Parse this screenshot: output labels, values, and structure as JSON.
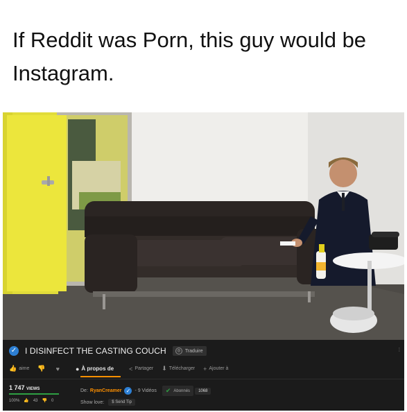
{
  "meme": {
    "caption": "If Reddit was Porn, this guy would be Instagram."
  },
  "video": {
    "title": "I DISINFECT THE CASTING COUCH",
    "translate_label": "Traduire",
    "actions": {
      "like": "aime",
      "about": "À propos de",
      "share": "Partager",
      "download": "Télécharger",
      "add": "Ajouter à"
    },
    "views_count": "1 747",
    "views_label": "VIEWS",
    "rating_percent": "100%",
    "rating_fraction": 1.0,
    "likes": "43",
    "dislikes": "0",
    "from_label": "De:",
    "uploader": "RyanCreamer",
    "video_count": "- 9 Vidéos",
    "subscribe_label": "Abonnés",
    "subscriber_count": "1068",
    "show_love_label": "Show love:",
    "send_tip_label": "Send Tip"
  },
  "colors": {
    "accent": "#ff9000",
    "verified": "#2d7fd3",
    "rating": "#2ea043"
  }
}
